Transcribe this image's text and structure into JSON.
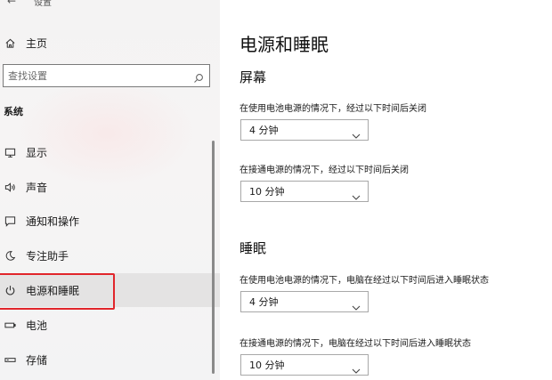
{
  "window": {
    "title": "设置"
  },
  "sidebar": {
    "home_label": "主页",
    "search_placeholder": "查找设置",
    "section_heading": "系统",
    "items": [
      {
        "label": "显示",
        "icon": "monitor-icon"
      },
      {
        "label": "声音",
        "icon": "speaker-icon"
      },
      {
        "label": "通知和操作",
        "icon": "notification-icon"
      },
      {
        "label": "专注助手",
        "icon": "moon-icon"
      },
      {
        "label": "电源和睡眠",
        "icon": "power-icon",
        "selected": true
      },
      {
        "label": "电池",
        "icon": "battery-icon"
      },
      {
        "label": "存储",
        "icon": "storage-icon"
      }
    ]
  },
  "main": {
    "title": "电源和睡眠",
    "screen": {
      "heading": "屏幕",
      "battery_label": "在使用电池电源的情况下，经过以下时间后关闭",
      "battery_value": "4 分钟",
      "plugged_label": "在接通电源的情况下，经过以下时间后关闭",
      "plugged_value": "10 分钟"
    },
    "sleep": {
      "heading": "睡眠",
      "battery_label": "在使用电池电源的情况下，电脑在经过以下时间后进入睡眠状态",
      "battery_value": "4 分钟",
      "plugged_label": "在接通电源的情况下，电脑在经过以下时间后进入睡眠状态",
      "plugged_value": "10 分钟"
    }
  },
  "colors": {
    "highlight_border": "#e1262b",
    "selected_background": "#e4e3e3",
    "sidebar_background": "#f4f3f3"
  }
}
